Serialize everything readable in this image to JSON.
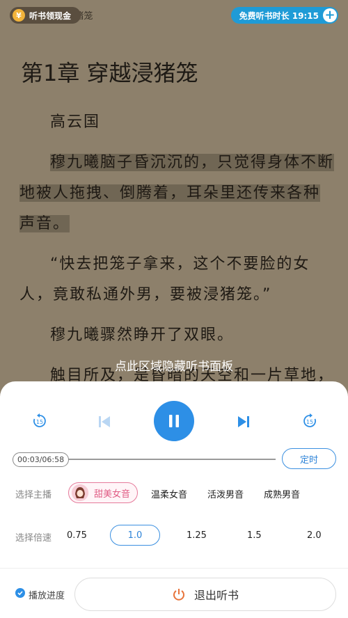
{
  "header": {
    "chapter_hint": "第1章 穿越浸猪笼",
    "cash_label": "听书领现金",
    "coin_glyph": "¥",
    "free_time_label": "免费听书时长 19:15",
    "plus_glyph": "+"
  },
  "content": {
    "chapter_title": "第1章  穿越浸猪笼",
    "paragraphs": [
      "高云国",
      "穆九曦脑子昏沉沉的，只觉得身体不断地被人拖拽、倒腾着，耳朵里还传来各种声音。",
      "“快去把笼子拿来，这个不要脸的女人，竟敢私通外男，要被浸猪笼。”",
      "穆九曦骤然睁开了双眼。",
      "触目所及，是昏暗的天空和一片草地，"
    ],
    "panel_hint": "点此区域隐藏听书面板"
  },
  "player": {
    "rewind_label": "15",
    "forward_label": "15",
    "time": "00:03/06:58",
    "progress_fraction": 0.007,
    "timer_label": "定时",
    "anchor_label": "选择主播",
    "voices": [
      "甜美女音",
      "温柔女音",
      "活泼男音",
      "成熟男音"
    ],
    "selected_voice": "甜美女音",
    "speed_label": "选择倍速",
    "speeds": [
      "0.75",
      "1.0",
      "1.25",
      "1.5",
      "2.0"
    ],
    "selected_speed": "1.0",
    "progress_check_label": "播放进度",
    "exit_label": "退出听书"
  },
  "colors": {
    "accent": "#2d8fe6",
    "voice_accent": "#e05c84",
    "reader_bg": "#8d806b",
    "exit_icon": "#e8743b"
  }
}
